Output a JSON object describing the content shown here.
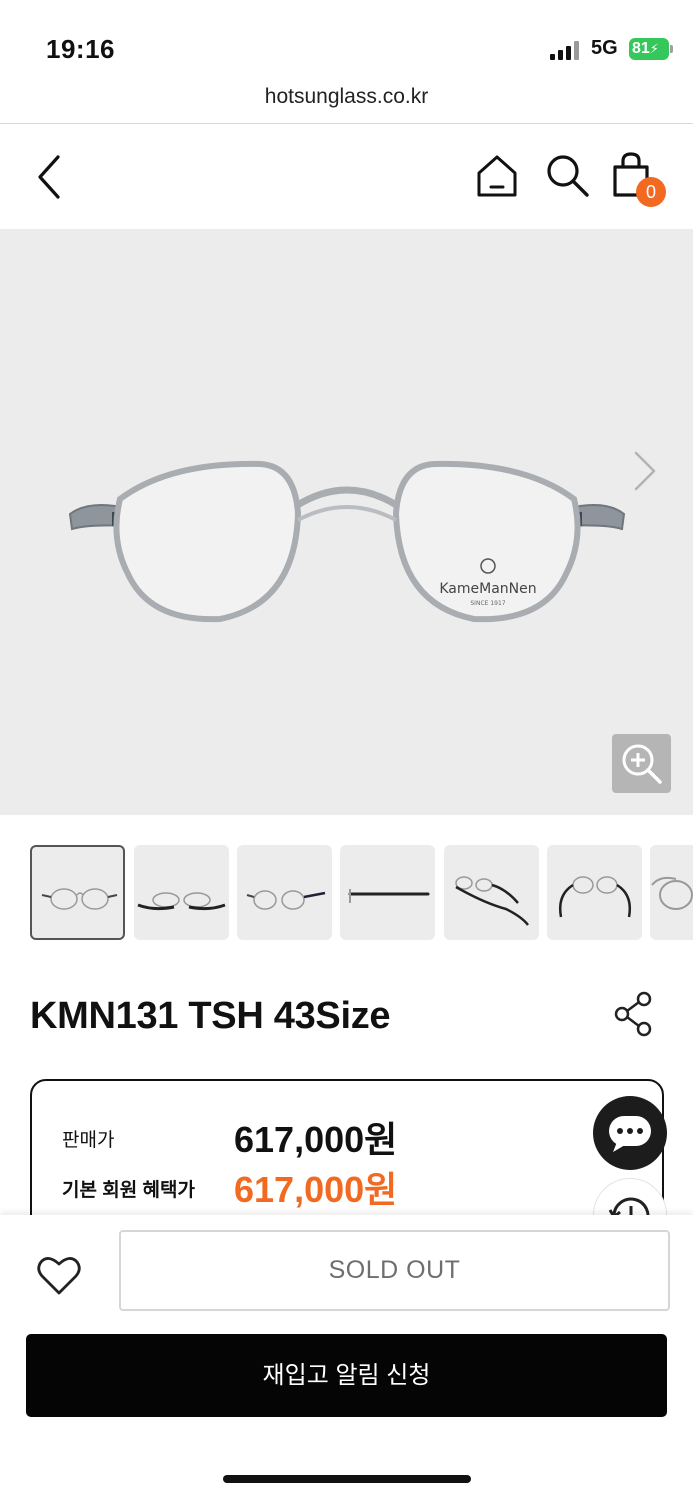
{
  "status_bar": {
    "time": "19:16",
    "network": "5G",
    "battery": "81",
    "icons": [
      "signal-icon",
      "battery-icon"
    ]
  },
  "browser": {
    "url": "hotsunglass.co.kr"
  },
  "header": {
    "icons": [
      "back-arrow-icon",
      "home-icon",
      "search-icon",
      "shopping-bag-icon"
    ],
    "cart_count": "0"
  },
  "gallery": {
    "brand_logo_text": "KameManNen",
    "brand_logo_since": "SINCE 1917",
    "thumbnail_count": 7,
    "active_thumbnail_index": 0,
    "icons": [
      "chevron-right-icon",
      "zoom-in-icon"
    ]
  },
  "product": {
    "title": "KMN131 TSH 43Size"
  },
  "pricing": {
    "sale_label": "판매가",
    "sale_price": "617,000원",
    "member_label": "기본 회원 혜택가",
    "member_price": "617,000원"
  },
  "floating": {
    "icons": [
      "chat-icon",
      "history-icon"
    ]
  },
  "actions": {
    "sold_out_label": "SOLD OUT",
    "restock_label": "재입고 알림 신청",
    "icons": [
      "heart-icon"
    ]
  },
  "colors": {
    "accent": "#f26a22",
    "battery": "#34c759",
    "primary_button": "#050505",
    "image_background": "#ececec"
  }
}
